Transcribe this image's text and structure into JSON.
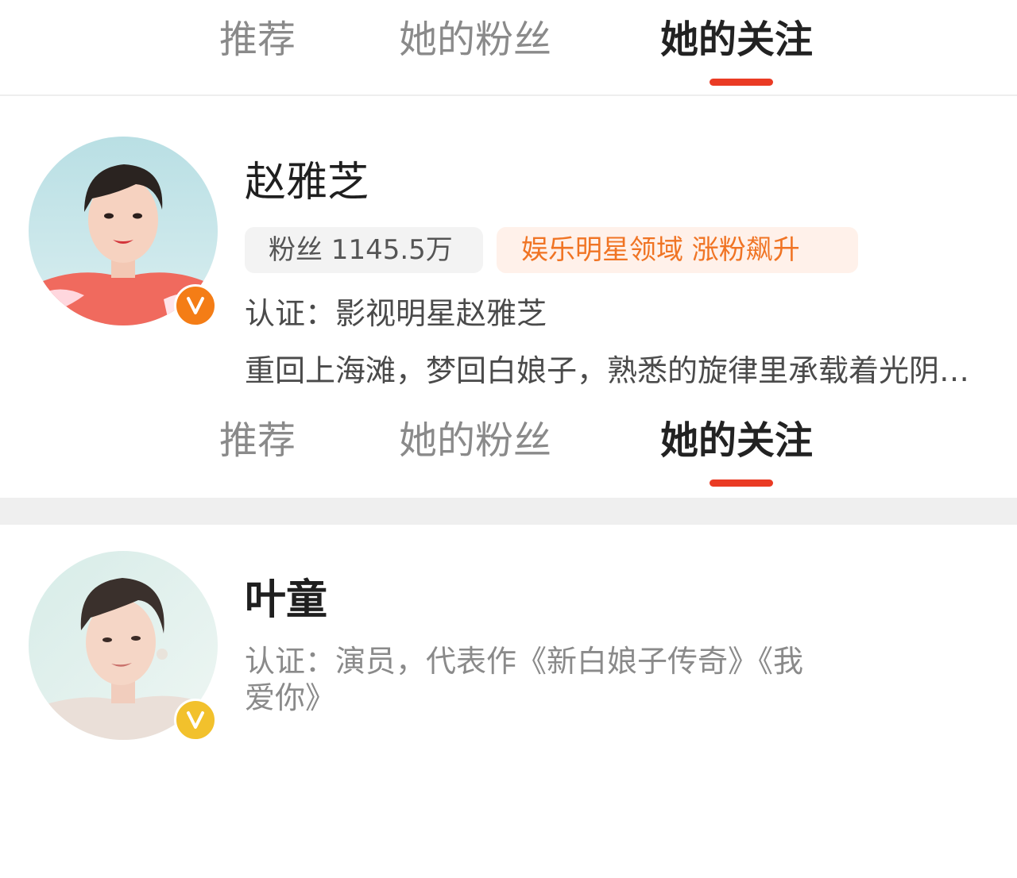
{
  "tabs_top": {
    "items": [
      {
        "label": "推荐",
        "active": false
      },
      {
        "label": "她的粉丝",
        "active": false
      },
      {
        "label": "她的关注",
        "active": true
      }
    ]
  },
  "tabs_mid": {
    "items": [
      {
        "label": "推荐",
        "active": false
      },
      {
        "label": "她的粉丝",
        "active": false
      },
      {
        "label": "她的关注",
        "active": true
      }
    ]
  },
  "users": [
    {
      "name": "赵雅芝",
      "fans": "粉丝 1145.5万",
      "tag": "娱乐明星领域 涨粉飙升",
      "verification": "认证：影视明星赵雅芝",
      "bio": "重回上海滩，梦回白娘子，熟悉的旋律里承载着光阴的回忆",
      "badge": "V",
      "badge_color": "#f47d16"
    },
    {
      "name": "叶童",
      "verification": "认证：演员，代表作《新白娘子传奇》《我爱你》",
      "badge": "V",
      "badge_color": "#f2c12c"
    }
  ],
  "colors": {
    "accent_red": "#ea3b24",
    "tag_orange": "#f07424",
    "tag_bg": "#fff1ea",
    "fans_bg": "#f3f3f3"
  },
  "icons": {
    "verified_badge": "verified-v-icon",
    "avatar": "user-avatar-photo"
  }
}
